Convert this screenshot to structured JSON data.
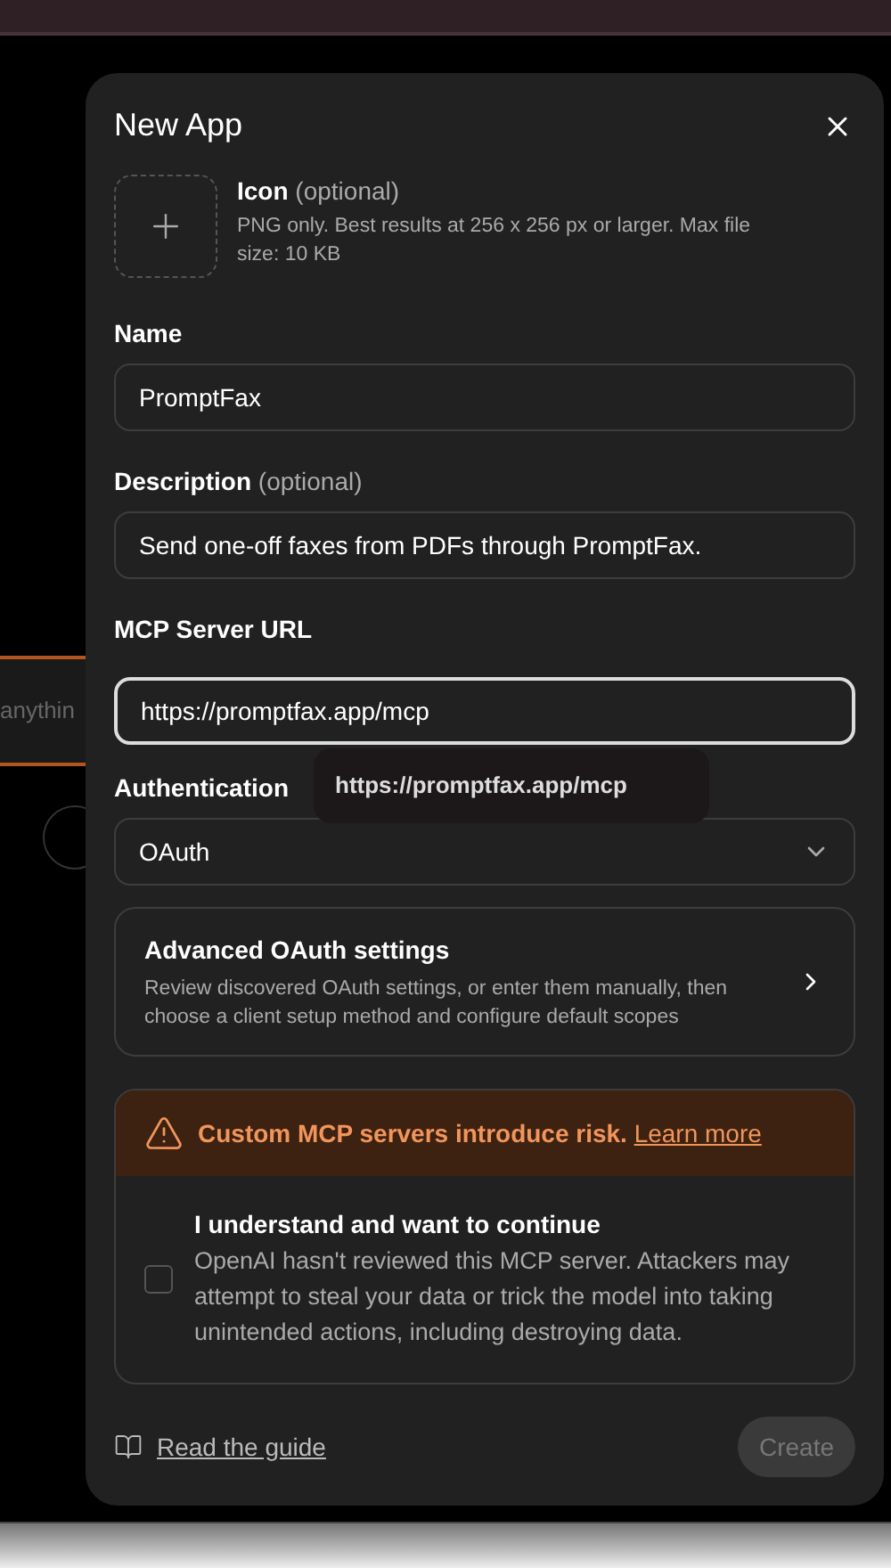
{
  "background": {
    "search_text": "anythin"
  },
  "dialog": {
    "title": "New App",
    "icon_upload": {
      "label": "Icon",
      "hint": "(optional)",
      "description": "PNG only. Best results at 256 x 256 px or larger. Max file size: 10 KB"
    },
    "fields": [
      {
        "kind": "text",
        "label": "Name",
        "value": "PromptFax",
        "focused": false
      },
      {
        "kind": "text",
        "label": "Description",
        "hint": "(optional)",
        "value": "Send one-off faxes from PDFs through PromptFax.",
        "focused": false
      },
      {
        "kind": "text",
        "label": "MCP Server URL",
        "value": "https://promptfax.app/mcp",
        "focused": true,
        "tooltip": "https://promptfax.app/mcp"
      },
      {
        "kind": "select",
        "label": "Authentication",
        "value": "OAuth",
        "focused": false
      }
    ],
    "advanced": {
      "title": "Advanced OAuth settings",
      "description": "Review discovered OAuth settings, or enter them manually, then choose a client setup method and configure default scopes"
    },
    "warning": {
      "text": "Custom MCP servers introduce risk.",
      "link": "Learn more"
    },
    "consent": {
      "title": "I understand and want to continue",
      "description": "OpenAI hasn't reviewed this MCP server. Attackers may attempt to steal your data or trick the model into taking unintended actions, including destroying data.",
      "checked": false
    },
    "guide_link": "Read the guide",
    "create_button": {
      "label": "Create",
      "disabled": true
    }
  }
}
